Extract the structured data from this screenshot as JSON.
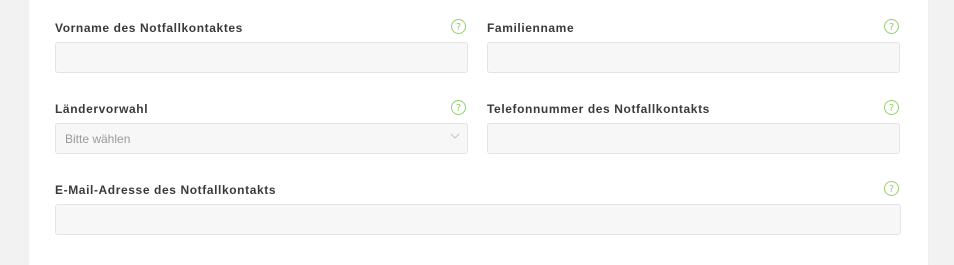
{
  "form": {
    "fields": [
      {
        "label": "Vorname des Notfallkontaktes",
        "value": "",
        "help": "?"
      },
      {
        "label": "Familienname",
        "value": "",
        "help": "?"
      },
      {
        "label": "Ländervorwahl",
        "value": "Bitte wählen",
        "help": "?"
      },
      {
        "label": "Telefonnummer des Notfallkontakts",
        "value": "",
        "help": "?"
      },
      {
        "label": "E-Mail-Adresse des Notfallkontakts",
        "value": "",
        "help": "?"
      }
    ]
  },
  "colors": {
    "help_accent": "#8fd16a",
    "input_bg": "#f7f7f7",
    "page_bg": "#f2f2f2"
  },
  "icons": {
    "help": "help-icon",
    "dropdown": "chevron-down-icon"
  }
}
